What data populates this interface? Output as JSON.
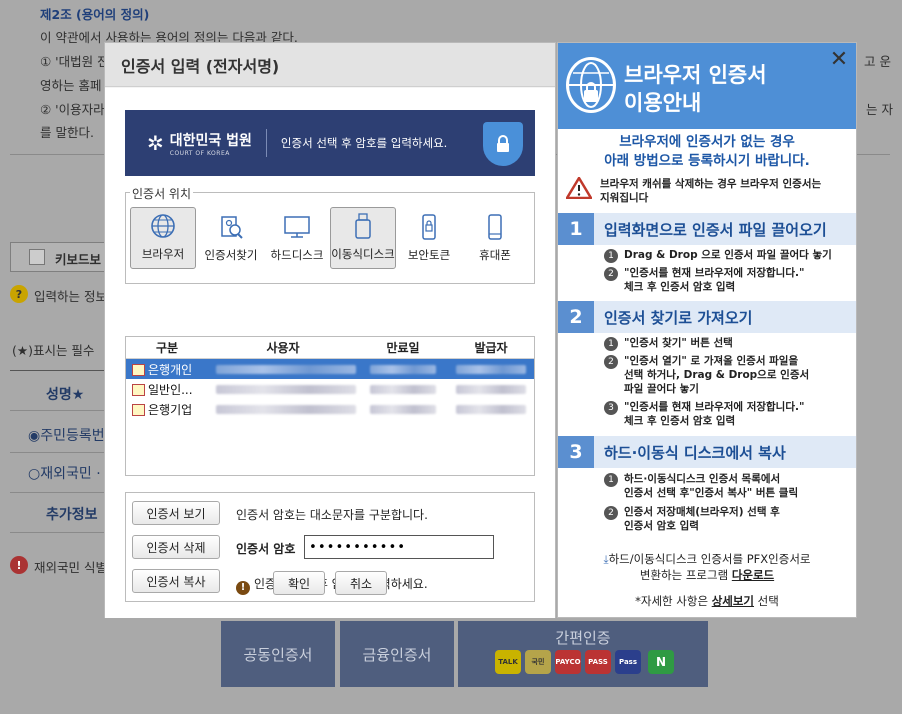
{
  "background": {
    "section_title": "제2조 (용어의 정의)",
    "line1": "이 약관에서 사용하는 용어의 정의는 다음과 같다.",
    "line2_start": "① '대법원 전",
    "line2_end": "고 운",
    "line3": "영하는 홈페",
    "line4_start": "② '이용자라",
    "line4_end": "는 자",
    "line5": "를 말한다.",
    "keyboard_label": "키보드보",
    "help_text": "입력하는 정보",
    "required_text": "(★)표시는 필수",
    "name_label": "성명★",
    "radio1": "주민등록번",
    "radio2": "재외국민 ·",
    "extra_label": "추가정보",
    "foreign_text": "재외국민 식별",
    "btn_joint": "공동인증서",
    "btn_finance": "금융인증서",
    "btn_simple": "간편인증",
    "simple_logos": [
      "TALK",
      "국민",
      "PAYCO",
      "PASS",
      "Pass",
      "N"
    ]
  },
  "dialog": {
    "title": "인증서 입력 (전자서명)",
    "banner": {
      "logo_kr": "대한민국 법원",
      "logo_en": "COURT OF KOREA",
      "message": "인증서 선택 후 암호를 입력하세요."
    },
    "location_legend": "인증서 위치",
    "locations": [
      {
        "label": "브라우저",
        "icon": "globe-icon",
        "selected": true
      },
      {
        "label": "인증서찾기",
        "icon": "search-doc-icon",
        "selected": false
      },
      {
        "label": "하드디스크",
        "icon": "monitor-icon",
        "selected": false
      },
      {
        "label": "이동식디스크",
        "icon": "usb-icon",
        "selected": true
      },
      {
        "label": "보안토큰",
        "icon": "token-icon",
        "selected": false
      },
      {
        "label": "휴대폰",
        "icon": "phone-icon",
        "selected": false
      }
    ],
    "table": {
      "headers": [
        "구분",
        "사용자",
        "만료일",
        "발급자"
      ],
      "rows": [
        {
          "type": "은행개인",
          "selected": true
        },
        {
          "type": "일반인...",
          "selected": false
        },
        {
          "type": "은행기업",
          "selected": false
        }
      ]
    },
    "actions": {
      "view": "인증서 보기",
      "delete": "인증서 삭제",
      "copy": "인증서 복사",
      "case_note": "인증서 암호는 대소문자를 구분합니다.",
      "password_label": "인증서 암호",
      "password_value": "•••••••••••",
      "hint": "인증서 선택 후 암호를 입력하세요."
    },
    "ok": "확인",
    "cancel": "취소"
  },
  "guide": {
    "title_line1": "브라우저 인증서",
    "title_line2": "이용안내",
    "intro_line1": "브라우저에 인증서가 없는 경우",
    "intro_line2": "아래 방법으로 등록하시기 바랍니다.",
    "warning_line1": "브라우저 캐쉬를 삭제하는 경우 브라우저 인증서는",
    "warning_line2": "지워집니다",
    "steps": [
      {
        "num": "1",
        "title": "입력화면으로 인증서 파일 끌어오기",
        "items": [
          "Drag & Drop 으로 인증서 파일 끌어다 놓기",
          "\"인증서를 현재 브라우저에 저장합니다.\"",
          "체크 후 인증서 암호 입력"
        ]
      },
      {
        "num": "2",
        "title": "인증서 찾기로 가져오기",
        "items": [
          "\"인증서 찾기\" 버튼 선택",
          "\"인증서 열기\" 로 가져올 인증서 파일을",
          "선택 하거나, Drag & Drop으로 인증서",
          "파일 끌어다 놓기",
          "\"인증서를 현재 브라우저에 저장합니다.\"",
          "체크 후 인증서 암호 입력"
        ]
      },
      {
        "num": "3",
        "title": "하드·이동식 디스크에서 복사",
        "items": [
          "하드·이동식디스크 인증서 목록에서",
          "인증서 선택 후\"인증서 복사\" 버튼 클릭",
          "인증서 저장매체(브라우저) 선택 후",
          "인증서 암호 입력"
        ]
      }
    ],
    "pfx_line1": "하드/이동식디스크 인증서를 PFX인증서로",
    "pfx_line2_pre": "변환하는 프로그램 ",
    "pfx_download": "다운로드",
    "detail_pre": "*자세한 사항은 ",
    "detail_link": "상세보기",
    "detail_post": " 선택",
    "colors": {
      "accent": "#4e8fd6",
      "step_blue": "#5b8fd0",
      "selected_row": "#3a77c9",
      "banner": "#2d3f73"
    }
  }
}
